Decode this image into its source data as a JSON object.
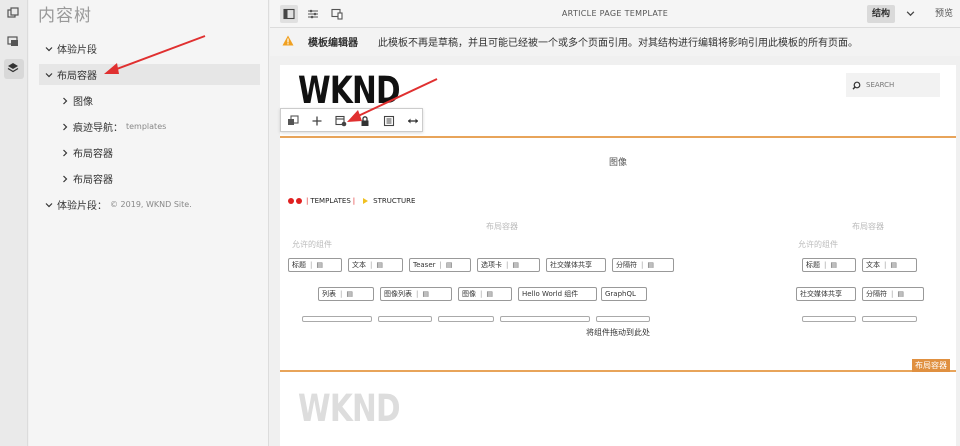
{
  "tree": {
    "title": "内容树",
    "items": [
      {
        "label": "体验片段",
        "sub": ""
      },
      {
        "label": "布局容器",
        "sub": ""
      },
      {
        "label": "图像",
        "sub": ""
      },
      {
        "label": "痕迹导航：",
        "sub": "templates"
      },
      {
        "label": "布局容器",
        "sub": ""
      },
      {
        "label": "布局容器",
        "sub": ""
      },
      {
        "label": "体验片段：",
        "sub": "© 2019, WKND Site."
      }
    ]
  },
  "topbar": {
    "page_title": "ARTICLE PAGE TEMPLATE",
    "mode_structure": "结构",
    "mode_preview": "预览"
  },
  "alert": {
    "title": "模板编辑器",
    "message": "此模板不再是草稿，并且可能已经被一个或多个页面引用。对其结构进行编辑将影响引用此模板的所有页面。"
  },
  "canvas": {
    "logo": "WKND",
    "search_placeholder": "SEARCH",
    "image_label": "图像",
    "breadcrumb": [
      "TEMPLATES",
      "STRUCTURE"
    ],
    "container_label_left": "布局容器",
    "container_label_right": "布局容器",
    "allowed_left": "允许的组件",
    "allowed_right": "允许的组件",
    "chips_left_row1": [
      "标题",
      "文本",
      "Teaser",
      "选项卡",
      "社交媒体共享",
      "分隔符"
    ],
    "chips_left_row2": [
      "列表",
      "图像列表",
      "图像",
      "Hello World 组件",
      "GraphQL"
    ],
    "chips_right_row1": [
      "标题",
      "文本"
    ],
    "chips_right_row2": [
      "社交媒体共享",
      "分隔符"
    ],
    "drop_hint": "将组件拖动到此处",
    "layout_tag": "布局容器",
    "footer_logo": "WKND"
  },
  "colors": {
    "container_border": "#e8a45a",
    "tag_bg": "#e09040",
    "arrow": "#e03030"
  }
}
